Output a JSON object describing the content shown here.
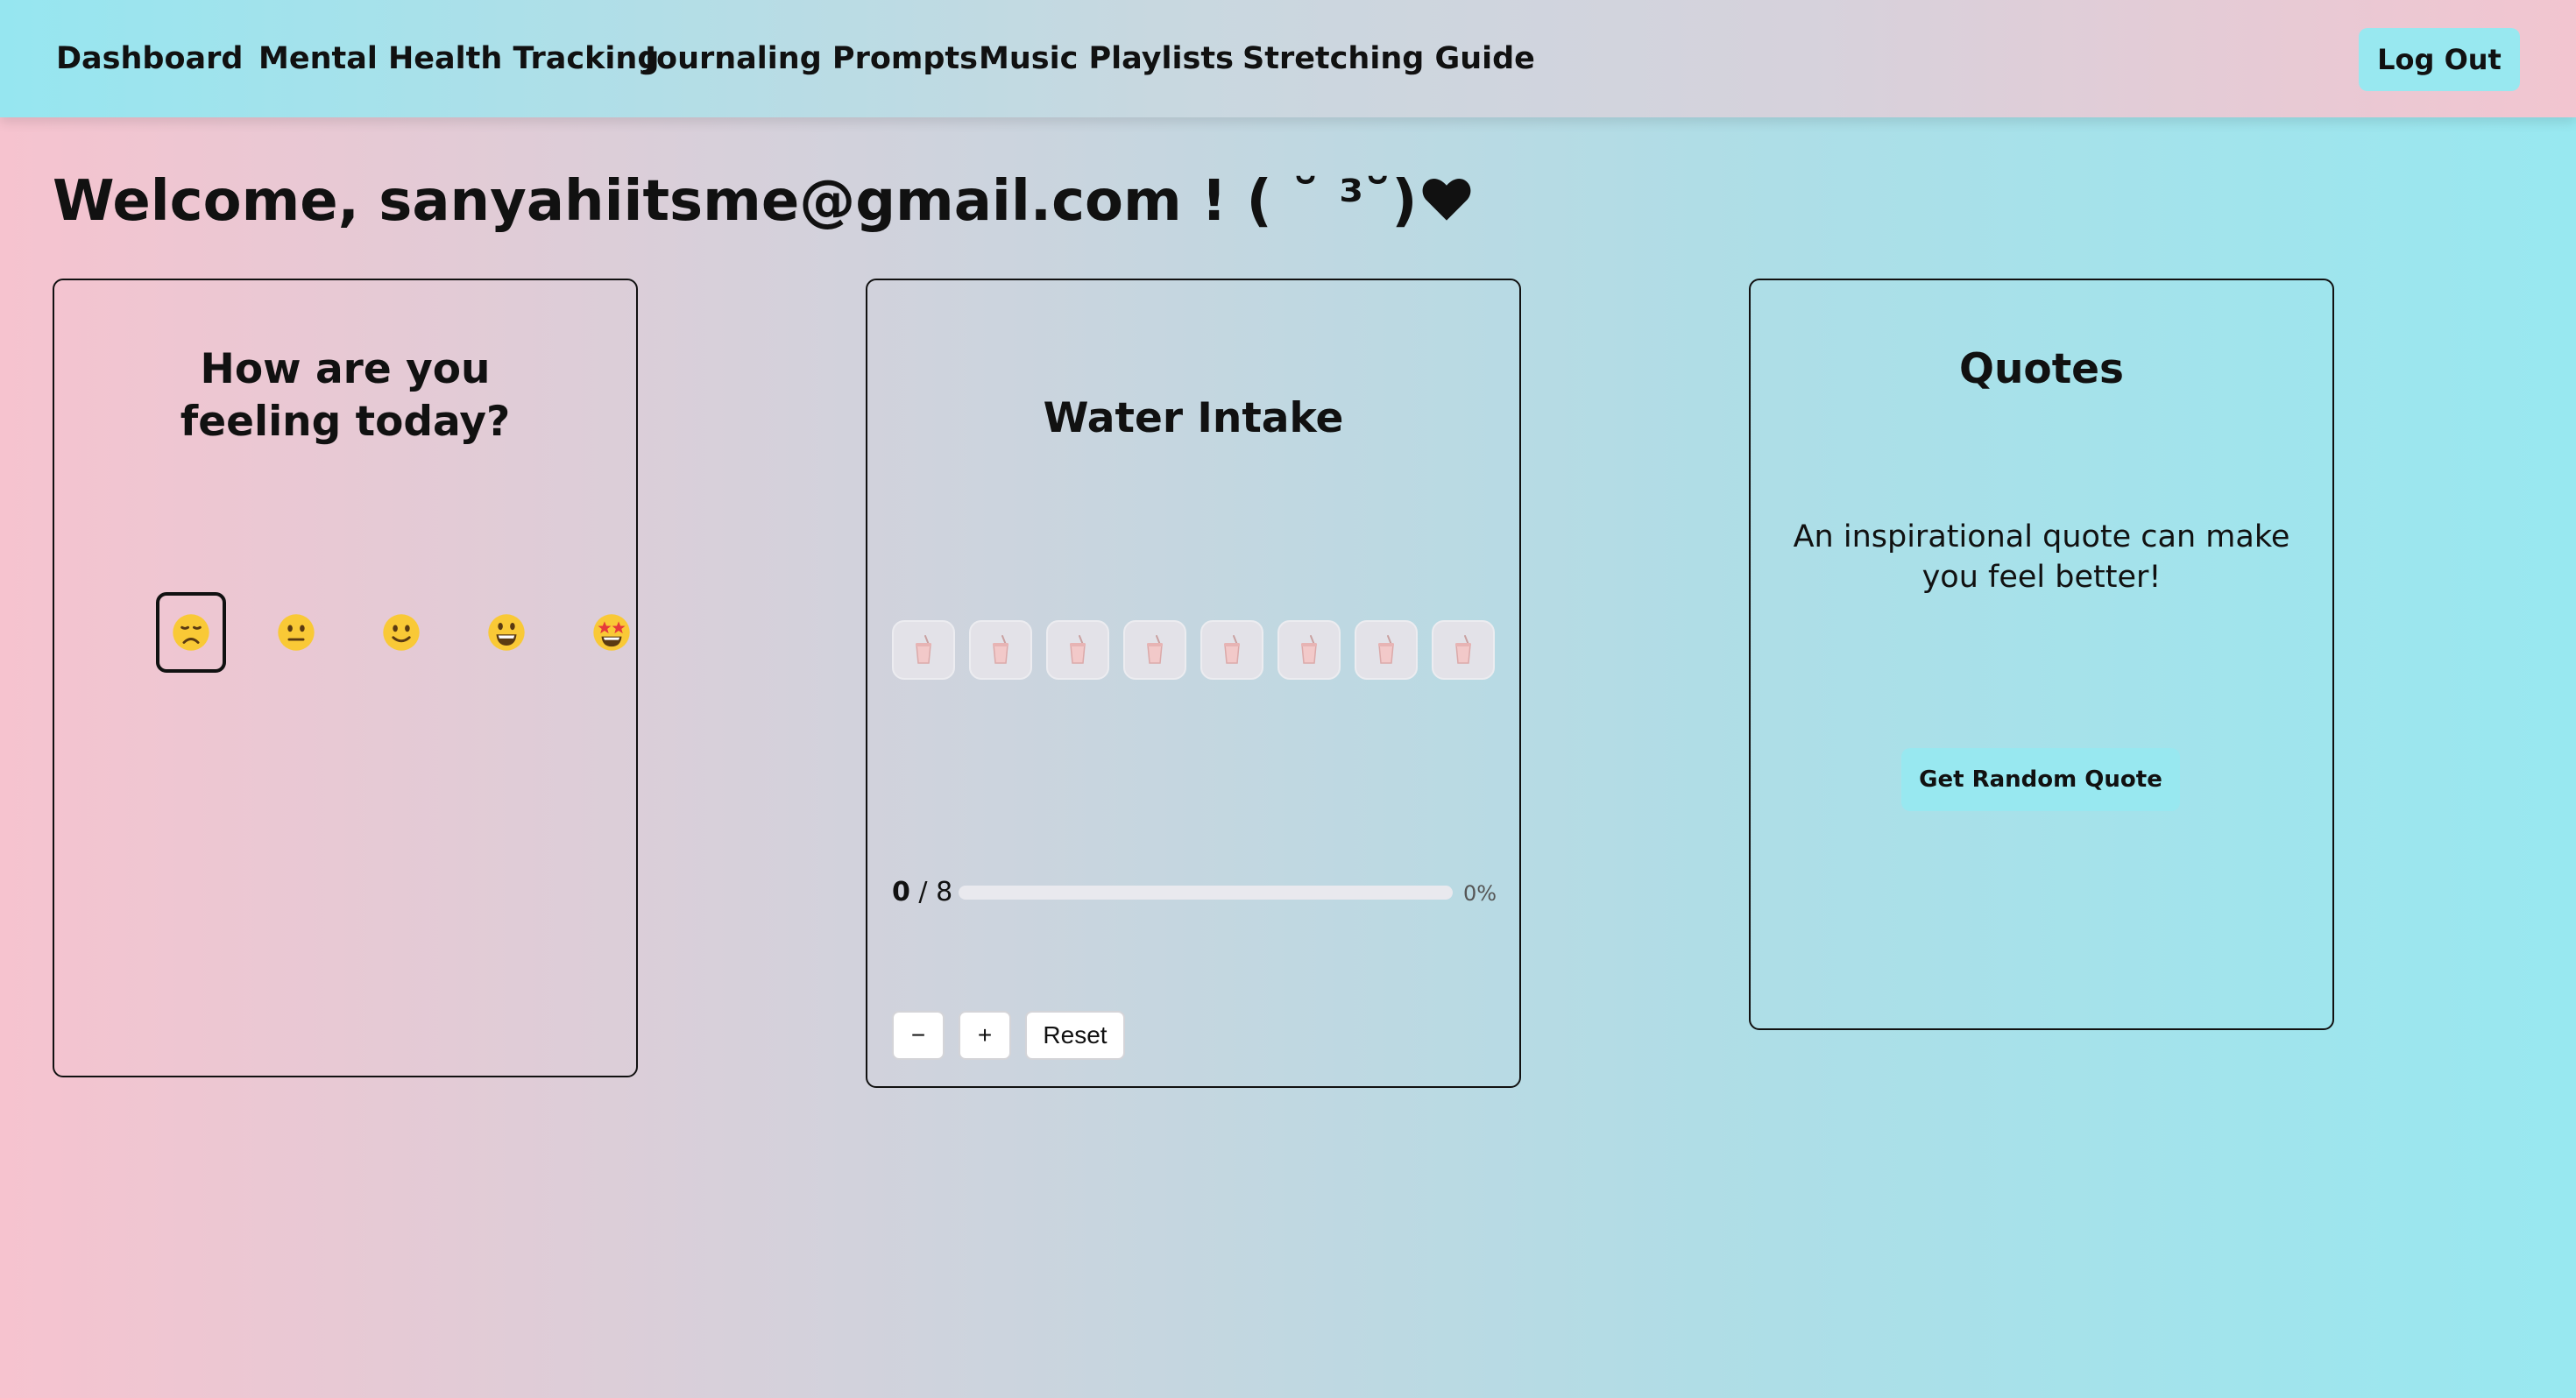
{
  "nav": {
    "links": [
      "Dashboard",
      "Mental Health Tracking",
      "Journaling Prompts",
      "Music Playlists",
      "Stretching Guide"
    ],
    "logout_label": "Log Out"
  },
  "welcome": {
    "text": "Welcome, sanyahiitsme@gmail.com ! ( ˘ ³˘)"
  },
  "mood_card": {
    "title": "How are you feeling today?",
    "moods": [
      "disappointed-face",
      "neutral-face",
      "slightly-smiling-face",
      "grinning-face",
      "star-struck-face"
    ],
    "selected_index": 0
  },
  "water_card": {
    "title": "Water Intake",
    "cups_total": 8,
    "count_value": "0",
    "count_total": "/ 8",
    "progress_percent": 0,
    "percent_label": "0%",
    "decrement_label": "−",
    "increment_label": "+",
    "reset_label": "Reset"
  },
  "quotes_card": {
    "title": "Quotes",
    "quote": "An inspirational quote can make you feel better!",
    "button_label": "Get Random Quote"
  },
  "colors": {
    "accent": "#98e8f0",
    "border": "#111111"
  }
}
